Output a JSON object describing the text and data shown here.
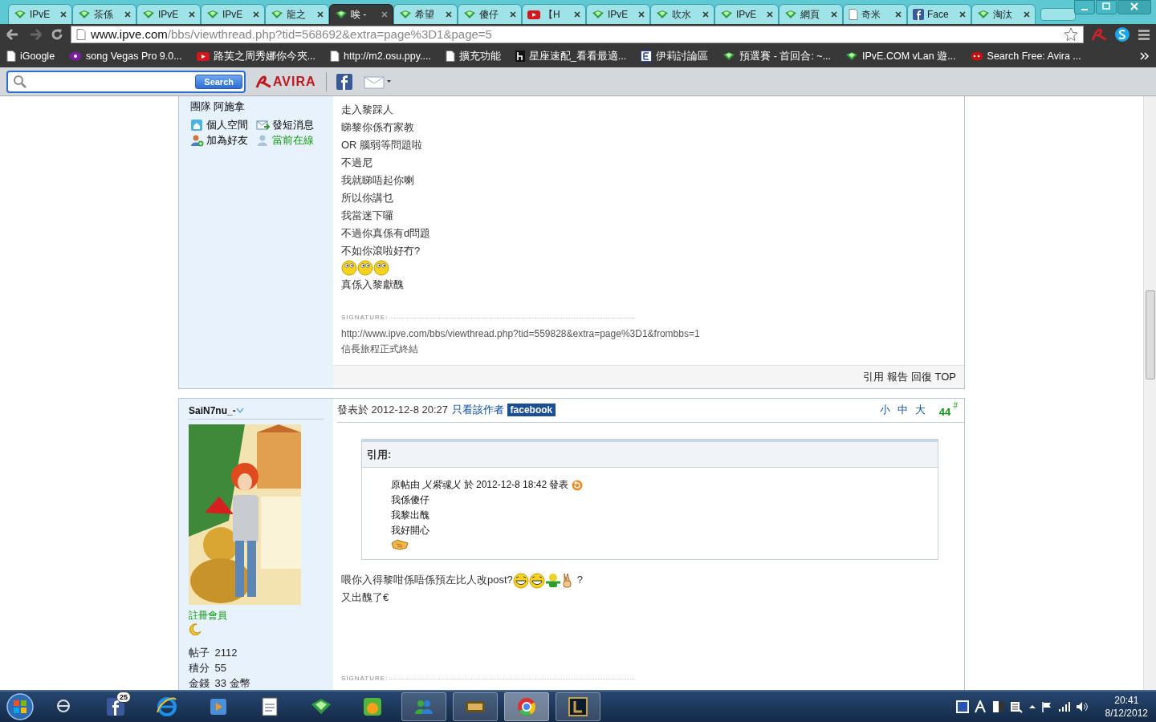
{
  "tabs": [
    {
      "label": "IPvE",
      "kind": "ipve",
      "selected": false
    },
    {
      "label": "茶係",
      "kind": "ipve",
      "selected": false
    },
    {
      "label": "IPvE",
      "kind": "ipve",
      "selected": false
    },
    {
      "label": "IPvE",
      "kind": "ipve",
      "selected": false
    },
    {
      "label": "龍之",
      "kind": "ipve",
      "selected": false
    },
    {
      "label": "唉 -",
      "kind": "ipve",
      "selected": true
    },
    {
      "label": "希望",
      "kind": "ipve",
      "selected": false
    },
    {
      "label": "傻仔",
      "kind": "ipve",
      "selected": false
    },
    {
      "label": "【H",
      "kind": "youtube",
      "selected": false
    },
    {
      "label": "IPvE",
      "kind": "ipve",
      "selected": false
    },
    {
      "label": "吹水",
      "kind": "ipve",
      "selected": false
    },
    {
      "label": "IPvE",
      "kind": "ipve",
      "selected": false
    },
    {
      "label": "網頁",
      "kind": "ipve",
      "selected": false
    },
    {
      "label": "奇米",
      "kind": "page",
      "selected": false
    },
    {
      "label": "Face",
      "kind": "facebook",
      "selected": false
    },
    {
      "label": "淘汰",
      "kind": "ipve",
      "selected": false
    }
  ],
  "address": {
    "host": "www.ipve.com",
    "path": "/bbs/viewthread.php?tid=568692&extra=page%3D1&page=5"
  },
  "bookmarks": [
    {
      "label": "iGoogle",
      "kind": "page"
    },
    {
      "label": "song Vegas Pro 9.0...",
      "kind": "yahoo"
    },
    {
      "label": "路芙之周秀娜你今夾...",
      "kind": "youtube"
    },
    {
      "label": "http://m2.osu.ppy....",
      "kind": "page"
    },
    {
      "label": "擴充功能",
      "kind": "page"
    },
    {
      "label": "星座速配_看看最適...",
      "kind": "h"
    },
    {
      "label": "伊莉討論區",
      "kind": "e"
    },
    {
      "label": "預選賽 - 首回合: ~...",
      "kind": "ipve"
    },
    {
      "label": "IPvE.COM vLan 遊...",
      "kind": "ipve"
    },
    {
      "label": "Search Free: Avira ...",
      "kind": "ask"
    }
  ],
  "toolbar": {
    "search_button": "Search",
    "logo": "AVIRA"
  },
  "post1": {
    "team_label": "團隊",
    "team": "阿施拿",
    "actions": [
      {
        "label": "個人空間",
        "kind": "home",
        "online": false
      },
      {
        "label": "發短消息",
        "kind": "mail",
        "online": false
      },
      {
        "label": "加為好友",
        "kind": "add-user",
        "online": false
      },
      {
        "label": "當前在線",
        "kind": "user",
        "online": true
      }
    ],
    "lines": [
      "走入黎踩人",
      "睇黎你係冇家教",
      "OR 腦弱等問題啦",
      "不過尼",
      "我就睇唔起你喇",
      "所以你講乜",
      "我當迷下囉",
      "不過你真係有d問題",
      "不如你滾啦好冇?"
    ],
    "emoticons": [
      {
        "kind": "eyes"
      },
      {
        "kind": "eyes"
      },
      {
        "kind": "eyes"
      }
    ],
    "after_line": "真係入黎獻醜",
    "signature_label": "SIGNATURE:",
    "signature": [
      "http://www.ipve.com/bbs/viewthread.php?tid=559828&extra=page%3D1&frombbs=1",
      "信長旅程正式終結"
    ],
    "footer_links": [
      "引用",
      "報告",
      "回復",
      "TOP"
    ]
  },
  "post2": {
    "author": "SaiN7nu_-",
    "rank": "註冊會員",
    "stats": [
      {
        "label": "帖子",
        "value": "2112"
      },
      {
        "label": "積分",
        "value": "55"
      },
      {
        "label": "金錢",
        "value": "33 金幣"
      }
    ],
    "posted": "發表於 2012-12-8 20:27",
    "author_only": "只看該作者",
    "share": "facebook",
    "font_sizes": [
      "小",
      "中",
      "大"
    ],
    "floor": "44",
    "floor_mark": "#",
    "quote_title": "引用:",
    "quote_header": "原帖由 *乂紫魂乂* 於 2012-12-8 18:42 發表",
    "quote_lines": [
      "我係傻仔",
      "我黎出醜",
      "我好開心"
    ],
    "quote_emoticons": [
      {
        "kind": "handshake"
      }
    ],
    "body_text": "喂你入得黎咁係唔係預左比人改post?",
    "body_emoticons": [
      {
        "kind": "grin"
      },
      {
        "kind": "grin"
      },
      {
        "kind": "green-figure"
      },
      {
        "kind": "peace-hand"
      }
    ],
    "body_tail": "?",
    "body_line2": "又出醜了€",
    "signature_label": "SIGNATURE:"
  },
  "taskbar": {
    "badge": "25",
    "time": "20:41",
    "date": "8/12/2012",
    "apps": [
      {
        "kind": "circle",
        "running": false
      },
      {
        "kind": "facebook",
        "running": false
      },
      {
        "kind": "ie",
        "running": false
      },
      {
        "kind": "player",
        "running": false
      },
      {
        "kind": "notepad",
        "running": false
      },
      {
        "kind": "ipve",
        "running": false
      },
      {
        "kind": "pps",
        "running": false
      },
      {
        "kind": "messenger",
        "running": true
      },
      {
        "kind": "lol",
        "running": true
      },
      {
        "kind": "chrome",
        "running": true,
        "selected": true
      },
      {
        "kind": "league",
        "running": true,
        "selected": false
      }
    ]
  }
}
